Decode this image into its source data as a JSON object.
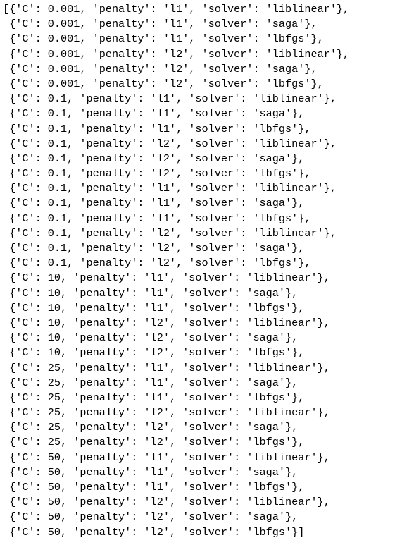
{
  "output": {
    "lines": [
      "[{'C': 0.001, 'penalty': 'l1', 'solver': 'liblinear'},",
      " {'C': 0.001, 'penalty': 'l1', 'solver': 'saga'},",
      " {'C': 0.001, 'penalty': 'l1', 'solver': 'lbfgs'},",
      " {'C': 0.001, 'penalty': 'l2', 'solver': 'liblinear'},",
      " {'C': 0.001, 'penalty': 'l2', 'solver': 'saga'},",
      " {'C': 0.001, 'penalty': 'l2', 'solver': 'lbfgs'},",
      " {'C': 0.1, 'penalty': 'l1', 'solver': 'liblinear'},",
      " {'C': 0.1, 'penalty': 'l1', 'solver': 'saga'},",
      " {'C': 0.1, 'penalty': 'l1', 'solver': 'lbfgs'},",
      " {'C': 0.1, 'penalty': 'l2', 'solver': 'liblinear'},",
      " {'C': 0.1, 'penalty': 'l2', 'solver': 'saga'},",
      " {'C': 0.1, 'penalty': 'l2', 'solver': 'lbfgs'},",
      " {'C': 0.1, 'penalty': 'l1', 'solver': 'liblinear'},",
      " {'C': 0.1, 'penalty': 'l1', 'solver': 'saga'},",
      " {'C': 0.1, 'penalty': 'l1', 'solver': 'lbfgs'},",
      " {'C': 0.1, 'penalty': 'l2', 'solver': 'liblinear'},",
      " {'C': 0.1, 'penalty': 'l2', 'solver': 'saga'},",
      " {'C': 0.1, 'penalty': 'l2', 'solver': 'lbfgs'},",
      " {'C': 10, 'penalty': 'l1', 'solver': 'liblinear'},",
      " {'C': 10, 'penalty': 'l1', 'solver': 'saga'},",
      " {'C': 10, 'penalty': 'l1', 'solver': 'lbfgs'},",
      " {'C': 10, 'penalty': 'l2', 'solver': 'liblinear'},",
      " {'C': 10, 'penalty': 'l2', 'solver': 'saga'},",
      " {'C': 10, 'penalty': 'l2', 'solver': 'lbfgs'},",
      " {'C': 25, 'penalty': 'l1', 'solver': 'liblinear'},",
      " {'C': 25, 'penalty': 'l1', 'solver': 'saga'},",
      " {'C': 25, 'penalty': 'l1', 'solver': 'lbfgs'},",
      " {'C': 25, 'penalty': 'l2', 'solver': 'liblinear'},",
      " {'C': 25, 'penalty': 'l2', 'solver': 'saga'},",
      " {'C': 25, 'penalty': 'l2', 'solver': 'lbfgs'},",
      " {'C': 50, 'penalty': 'l1', 'solver': 'liblinear'},",
      " {'C': 50, 'penalty': 'l1', 'solver': 'saga'},",
      " {'C': 50, 'penalty': 'l1', 'solver': 'lbfgs'},",
      " {'C': 50, 'penalty': 'l2', 'solver': 'liblinear'},",
      " {'C': 50, 'penalty': 'l2', 'solver': 'saga'},",
      " {'C': 50, 'penalty': 'l2', 'solver': 'lbfgs'}]"
    ]
  },
  "colors": {
    "background": "#ffffff",
    "text": "#000000"
  }
}
